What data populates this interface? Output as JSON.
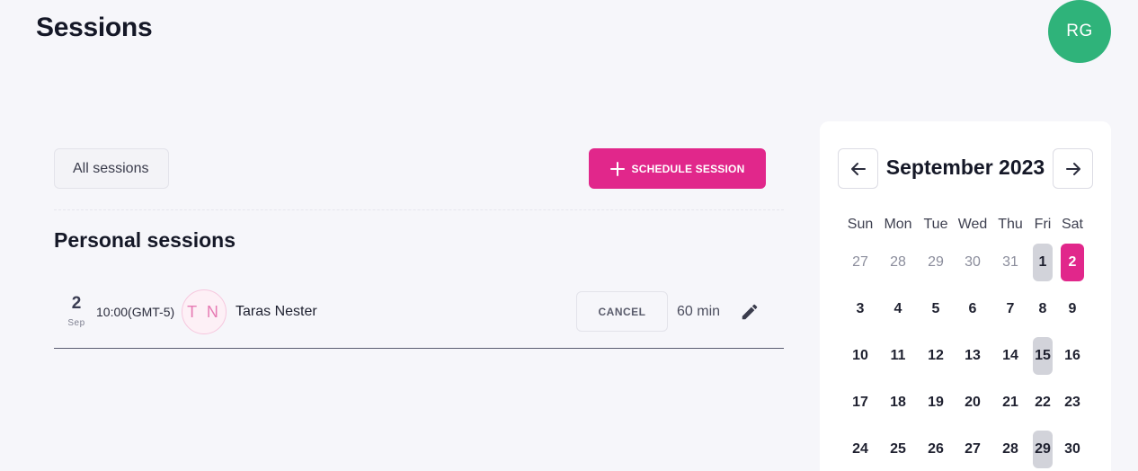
{
  "header": {
    "title": "Sessions",
    "avatar_initials": "RG",
    "avatar_color": "#2fb37a"
  },
  "toolbar": {
    "filter_label": "All sessions",
    "schedule_label": "SCHEDULE SESSION",
    "accent": "#e1278b"
  },
  "section": {
    "title": "Personal sessions"
  },
  "sessions": [
    {
      "day": "2",
      "month": "Sep",
      "time": "10:00(GMT-5)",
      "initials": "T N",
      "name": "Taras Nester",
      "cancel_label": "CANCEL",
      "duration": "60 min"
    }
  ],
  "calendar": {
    "month_label": "September 2023",
    "weekdays": [
      "Sun",
      "Mon",
      "Tue",
      "Wed",
      "Thu",
      "Fri",
      "Sat"
    ],
    "weeks": [
      [
        {
          "d": "27",
          "muted": true
        },
        {
          "d": "28",
          "muted": true
        },
        {
          "d": "29",
          "muted": true
        },
        {
          "d": "30",
          "muted": true
        },
        {
          "d": "31",
          "muted": true
        },
        {
          "d": "1",
          "session": true
        },
        {
          "d": "2",
          "selected": true
        }
      ],
      [
        {
          "d": "3"
        },
        {
          "d": "4"
        },
        {
          "d": "5"
        },
        {
          "d": "6"
        },
        {
          "d": "7"
        },
        {
          "d": "8"
        },
        {
          "d": "9"
        }
      ],
      [
        {
          "d": "10"
        },
        {
          "d": "11"
        },
        {
          "d": "12"
        },
        {
          "d": "13"
        },
        {
          "d": "14"
        },
        {
          "d": "15",
          "session": true
        },
        {
          "d": "16"
        }
      ],
      [
        {
          "d": "17"
        },
        {
          "d": "18"
        },
        {
          "d": "19"
        },
        {
          "d": "20"
        },
        {
          "d": "21"
        },
        {
          "d": "22"
        },
        {
          "d": "23"
        }
      ],
      [
        {
          "d": "24"
        },
        {
          "d": "25"
        },
        {
          "d": "26"
        },
        {
          "d": "27"
        },
        {
          "d": "28"
        },
        {
          "d": "29",
          "session": true
        },
        {
          "d": "30"
        }
      ]
    ]
  }
}
